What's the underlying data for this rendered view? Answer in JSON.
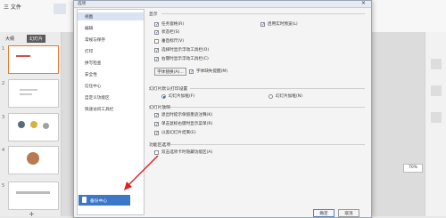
{
  "app": {
    "file_menu": "三 文件",
    "left_tabs": [
      "大纲",
      "幻灯片"
    ],
    "slide_numbers": [
      "1",
      "2",
      "3",
      "4",
      "5"
    ],
    "right_zoom": "70%"
  },
  "dialog": {
    "title": "选项",
    "nav_items": [
      "视图",
      "编辑",
      "常规与保存",
      "打印",
      "拼写检查",
      "安全性",
      "信任中心",
      "自定义功能区",
      "快速访问工具栏"
    ],
    "backup_label": "备份中心",
    "sections": {
      "display": "显示",
      "print_default": "幻灯片默认打印设置",
      "slideshow": "幻灯片放映",
      "function_options": "功能区选项"
    },
    "display_checks_left": [
      {
        "label": "任务窗格(R)",
        "checked": true
      },
      {
        "label": "状态栏(S)",
        "checked": true
      },
      {
        "label": "垂直标尺(V)",
        "checked": false
      },
      {
        "label": "选择时显示浮动工具栏(O)",
        "checked": true
      },
      {
        "label": "右键时显示浮动工具栏(C)",
        "checked": true
      }
    ],
    "display_checks_right": [
      {
        "label": "启用实时预览(L)",
        "checked": true
      }
    ],
    "font_select_label": "字体替换(A)...",
    "font_hint_label": "字体缺失提醒(M)",
    "print_radios": [
      {
        "label": "幻灯片加框(F)",
        "checked": true
      },
      {
        "label": "幻灯片加框(N)",
        "checked": false
      }
    ],
    "slideshow_checks": [
      {
        "label": "退出时提示保留墨迹注释(K)",
        "checked": true
      },
      {
        "label": "单击鼠标右键时显示菜单(R)",
        "checked": true
      },
      {
        "label": "以黑幻灯片结束(E)",
        "checked": true
      }
    ],
    "function_checks": [
      {
        "label": "双击选项卡时隐藏功能区(A)",
        "checked": false
      }
    ],
    "ok_label": "确定",
    "cancel_label": "取消"
  },
  "colors": {
    "accent": "#3c78c8",
    "arrow": "#e02020"
  }
}
